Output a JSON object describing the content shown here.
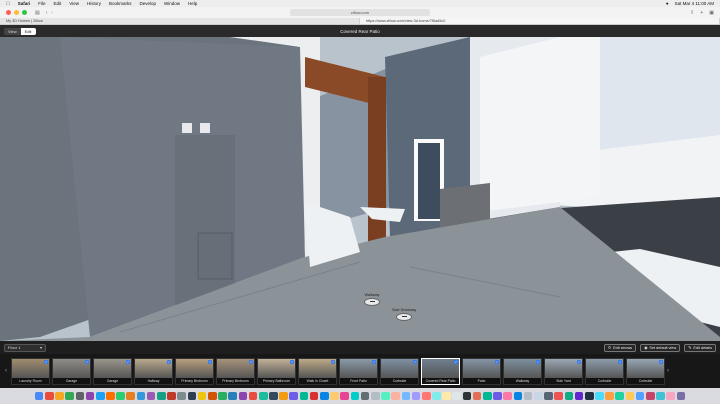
{
  "menubar": {
    "items": [
      "Safari",
      "File",
      "Edit",
      "View",
      "History",
      "Bookmarks",
      "Develop",
      "Window",
      "Help"
    ],
    "clock": "Sat Mar 4  11:00 AM"
  },
  "browser": {
    "url": "zillow.com",
    "tabs": [
      {
        "label": "My 3D Homes | Zillow",
        "active": false
      },
      {
        "label": "https://www.zillow.com/view-3d-home/7f5ad5c0",
        "active": true
      }
    ]
  },
  "viewer_header": {
    "mode_view": "View",
    "mode_edit": "Edit",
    "title": "Covered Rear Patio"
  },
  "hotspots": [
    {
      "label": "Walkway"
    },
    {
      "label": "Side Driveway"
    }
  ],
  "controls": {
    "floor_select": "Floor 1",
    "edit_arrows": "Edit arrows",
    "set_default_view": "Set default view",
    "edit_details": "Edit details"
  },
  "thumbnails": [
    {
      "label": "Laundry Room",
      "color": "#a08c6e"
    },
    {
      "label": "Garage",
      "color": "#8e8c86"
    },
    {
      "label": "Garage",
      "color": "#9a958c"
    },
    {
      "label": "Hallway",
      "color": "#b9a98c"
    },
    {
      "label": "Primary Bedroom",
      "color": "#b8a07c"
    },
    {
      "label": "Primary Bedroom",
      "color": "#a7927a"
    },
    {
      "label": "Primary Bathroom",
      "color": "#c1b197"
    },
    {
      "label": "Walk In Closet",
      "color": "#bda986"
    },
    {
      "label": "Front Patio",
      "color": "#8a9aa8"
    },
    {
      "label": "Curbside",
      "color": "#7f90a4"
    },
    {
      "label": "Covered Rear Patio",
      "color": "#6f7f8e"
    },
    {
      "label": "Patio",
      "color": "#8595a6"
    },
    {
      "label": "Walkway",
      "color": "#7d8e9e"
    },
    {
      "label": "Side Yard",
      "color": "#9aa7b4"
    },
    {
      "label": "Curbside",
      "color": "#8c9cab"
    },
    {
      "label": "Curbside",
      "color": "#96a5b3"
    }
  ],
  "dock_colors": [
    "#4a8af4",
    "#e94b3c",
    "#f5a623",
    "#34a853",
    "#5f6368",
    "#8e44ad",
    "#1da1f2",
    "#ff6f00",
    "#2ecc71",
    "#e67e22",
    "#3498db",
    "#9b59b6",
    "#16a085",
    "#c0392b",
    "#7f8c8d",
    "#2c3e50",
    "#f1c40f",
    "#d35400",
    "#27ae60",
    "#2980b9",
    "#8e44ad",
    "#e74c3c",
    "#1abc9c",
    "#34495e",
    "#f39c12",
    "#6c5ce7",
    "#00b894",
    "#d63031",
    "#0984e3",
    "#fdcb6e",
    "#e84393",
    "#00cec9",
    "#636e72",
    "#b2bec3",
    "#55efc4",
    "#fab1a0",
    "#74b9ff",
    "#a29bfe",
    "#ff7675",
    "#81ecec",
    "#ffeaa7",
    "#dfe6e9",
    "#2d3436",
    "#e17055",
    "#00b894",
    "#6c5ce7",
    "#fd79a8",
    "#0984e3",
    "#b2bec3",
    "#c8d6e5",
    "#576574",
    "#ee5253",
    "#10ac84",
    "#5f27cd",
    "#222f3e",
    "#48dbfb",
    "#ff9f43",
    "#1dd1a1",
    "#feca57",
    "#54a0ff",
    "#c44569",
    "#3dc1d3",
    "#f8a5c2",
    "#786fa6"
  ]
}
